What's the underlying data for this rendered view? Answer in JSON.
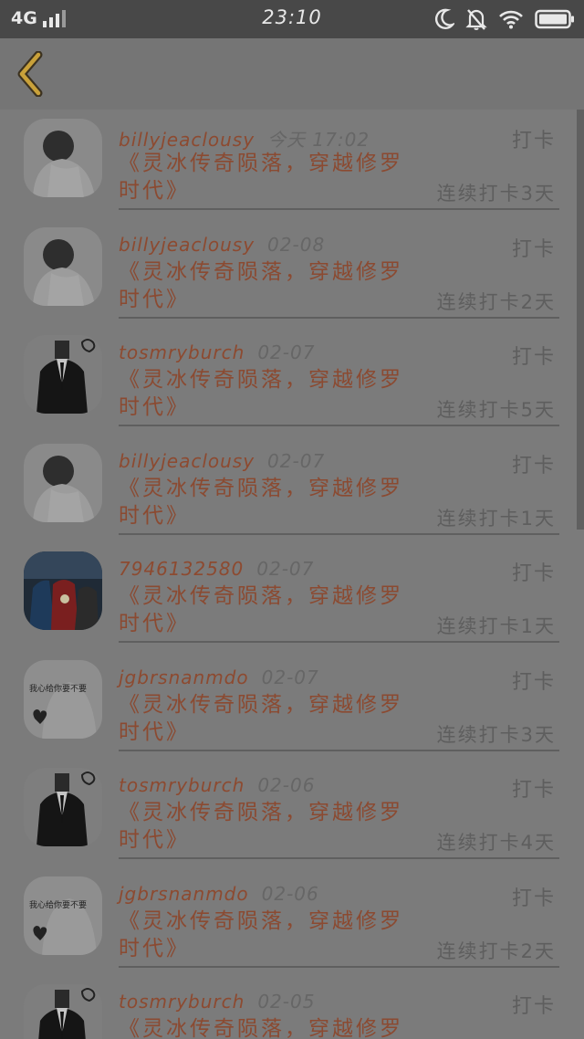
{
  "status_bar": {
    "network": "4G",
    "time": "23:10",
    "icons": [
      "signal-icon",
      "moon-icon",
      "mute-bell-icon",
      "wifi-icon",
      "battery-icon"
    ]
  },
  "header": {
    "back_icon": "chevron-left-icon"
  },
  "colors": {
    "username": "#8d4a30",
    "title": "#8b4a31",
    "meta": "#5e5e5e",
    "back": "#c9a13a"
  },
  "list": [
    {
      "avatar": "avatar-white-shirt",
      "username": "billyjeaclousy",
      "date": "今天 17:02",
      "title": "《灵冰传奇陨落，穿越修罗时代》",
      "action": "打卡",
      "streak": "连续打卡3天"
    },
    {
      "avatar": "avatar-white-shirt",
      "username": "billyjeaclousy",
      "date": "02-08",
      "title": "《灵冰传奇陨落，穿越修罗时代》",
      "action": "打卡",
      "streak": "连续打卡2天"
    },
    {
      "avatar": "avatar-black-suit",
      "username": "tosmryburch",
      "date": "02-07",
      "title": "《灵冰传奇陨落，穿越修罗时代》",
      "action": "打卡",
      "streak": "连续打卡5天"
    },
    {
      "avatar": "avatar-white-shirt",
      "username": "billyjeaclousy",
      "date": "02-07",
      "title": "《灵冰传奇陨落，穿越修罗时代》",
      "action": "打卡",
      "streak": "连续打卡1天"
    },
    {
      "avatar": "avatar-heroes",
      "username": "7946132580",
      "date": "02-07",
      "title": "《灵冰传奇陨落，穿越修罗时代》",
      "action": "打卡",
      "streak": "连续打卡1天"
    },
    {
      "avatar": "avatar-text-photo",
      "username": "jgbrsnanmdo",
      "date": "02-07",
      "title": "《灵冰传奇陨落，穿越修罗时代》",
      "action": "打卡",
      "streak": "连续打卡3天"
    },
    {
      "avatar": "avatar-black-suit",
      "username": "tosmryburch",
      "date": "02-06",
      "title": "《灵冰传奇陨落，穿越修罗时代》",
      "action": "打卡",
      "streak": "连续打卡4天"
    },
    {
      "avatar": "avatar-text-photo",
      "username": "jgbrsnanmdo",
      "date": "02-06",
      "title": "《灵冰传奇陨落，穿越修罗时代》",
      "action": "打卡",
      "streak": "连续打卡2天"
    },
    {
      "avatar": "avatar-black-suit",
      "username": "tosmryburch",
      "date": "02-05",
      "title": "《灵冰传奇陨落，穿越修罗时代》",
      "action": "打卡",
      "streak": ""
    }
  ],
  "avatar_text": "我心给你要不要"
}
